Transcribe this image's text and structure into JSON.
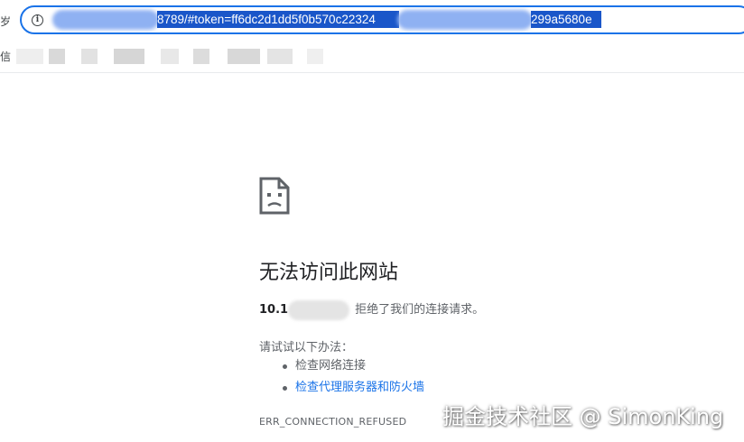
{
  "toolbar": {
    "left_edge_char": "岁"
  },
  "address_bar": {
    "url_visible": "8789/#token=ff6dc2d1dd5f0b570c22324",
    "url_visible_end": "299a5680e",
    "info_icon": "info-icon",
    "accent_color": "#1a73e8",
    "selection_color": "#1a56c9"
  },
  "bookmarks_bar": {
    "left_edge_char": "信"
  },
  "error_page": {
    "icon": "sad-page-icon",
    "title": "无法访问此网站",
    "host_prefix": "10.1",
    "refused_message": "拒绝了我们的连接请求。",
    "try_label": "请试试以下办法：",
    "suggestions": [
      {
        "label": "检查网络连接",
        "is_link": false
      },
      {
        "label": "检查代理服务器和防火墙",
        "is_link": true
      }
    ],
    "error_code": "ERR_CONNECTION_REFUSED",
    "link_color": "#1a73e8"
  },
  "watermark": {
    "text": "掘金技术社区 @ SimonKing"
  }
}
